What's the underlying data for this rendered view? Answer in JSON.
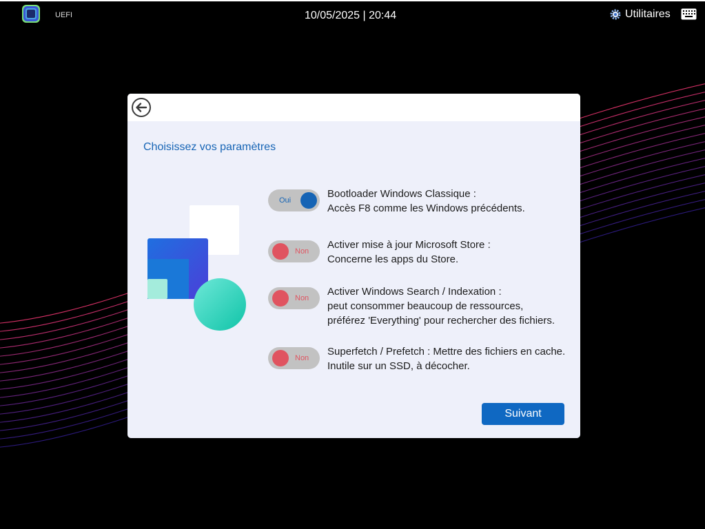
{
  "topbar": {
    "label": "UEFI",
    "datetime": "10/05/2025 | 20:44",
    "tools_label": "Utilitaires"
  },
  "icons": {
    "logo": "app-logo-icon",
    "tools": "gear-icon",
    "keyboard": "keyboard-icon",
    "back": "back-arrow-icon"
  },
  "dialog": {
    "title": "Choisissez vos paramètres",
    "options": [
      {
        "state": "Oui",
        "enabled": true,
        "line1": "Bootloader Windows Classique :",
        "line2": "Accès F8 comme les Windows précédents.",
        "line3": ""
      },
      {
        "state": "Non",
        "enabled": false,
        "line1": "Activer mise à jour Microsoft Store :",
        "line2": "Concerne les apps du Store.",
        "line3": ""
      },
      {
        "state": "Non",
        "enabled": false,
        "line1": "Activer Windows Search / Indexation :",
        "line2": "peut consommer beaucoup de ressources,",
        "line3": "préférez 'Everything' pour rechercher des fichiers."
      },
      {
        "state": "Non",
        "enabled": false,
        "line1": "Superfetch / Prefetch : Mettre des fichiers en cache.",
        "line2": "Inutile sur un SSD, à décocher.",
        "line3": ""
      }
    ],
    "next_label": "Suivant"
  },
  "colors": {
    "accent": "#0f68c2",
    "toggle_on": "#1664b5",
    "toggle_off": "#e05460",
    "dialog_bg": "#eef0fa",
    "wave_pink": "#e0336a",
    "wave_purple": "#4a2bd0"
  }
}
